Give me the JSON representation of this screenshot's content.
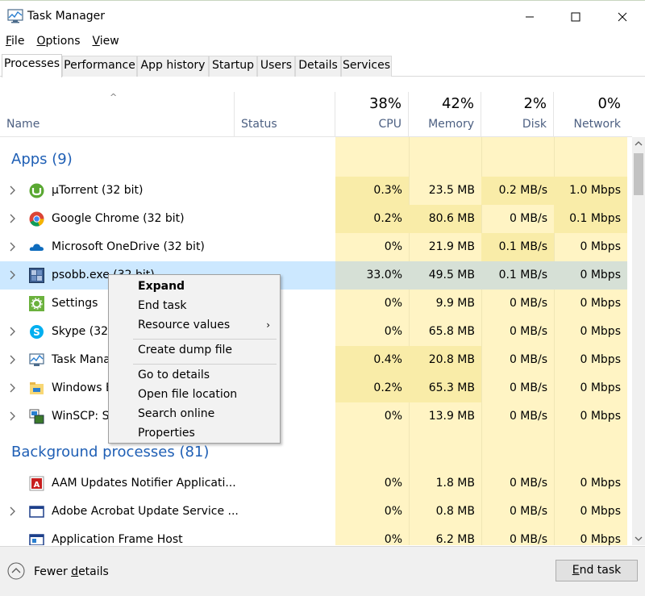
{
  "window": {
    "title": "Task Manager"
  },
  "menu": [
    {
      "label": "F",
      "rest": "ile"
    },
    {
      "label": "O",
      "rest": "ptions"
    },
    {
      "label": "V",
      "rest": "iew"
    }
  ],
  "tabs": [
    "Processes",
    "Performance",
    "App history",
    "Startup",
    "Users",
    "Details",
    "Services"
  ],
  "header": {
    "name": "Name",
    "status": "Status",
    "cpu_pct": "38%",
    "cpu": "CPU",
    "mem_pct": "42%",
    "mem": "Memory",
    "disk_pct": "2%",
    "disk": "Disk",
    "net_pct": "0%",
    "net": "Network"
  },
  "groups": {
    "apps": "Apps (9)",
    "background": "Background processes (81)"
  },
  "rows": [
    {
      "name": "µTorrent (32 bit)",
      "cpu": "0.3%",
      "mem": "23.5 MB",
      "disk": "0.2 MB/s",
      "net": "1.0 Mbps"
    },
    {
      "name": "Google Chrome (32 bit)",
      "cpu": "0.2%",
      "mem": "80.6 MB",
      "disk": "0 MB/s",
      "net": "0.1 Mbps"
    },
    {
      "name": "Microsoft OneDrive (32 bit)",
      "cpu": "0%",
      "mem": "21.9 MB",
      "disk": "0.1 MB/s",
      "net": "0 Mbps"
    },
    {
      "name": "psobb.exe (32 bit)",
      "cpu": "33.0%",
      "mem": "49.5 MB",
      "disk": "0.1 MB/s",
      "net": "0 Mbps"
    },
    {
      "name": "Settings",
      "cpu": "0%",
      "mem": "9.9 MB",
      "disk": "0 MB/s",
      "net": "0 Mbps"
    },
    {
      "name": "Skype (32 bit)",
      "cpu": "0%",
      "mem": "65.8 MB",
      "disk": "0 MB/s",
      "net": "0 Mbps"
    },
    {
      "name": "Task Manager",
      "cpu": "0.4%",
      "mem": "20.8 MB",
      "disk": "0 MB/s",
      "net": "0 Mbps"
    },
    {
      "name": "Windows Explorer",
      "cpu": "0.2%",
      "mem": "65.3 MB",
      "disk": "0 MB/s",
      "net": "0 Mbps"
    },
    {
      "name": "WinSCP: SFTP",
      "cpu": "0%",
      "mem": "13.9 MB",
      "disk": "0 MB/s",
      "net": "0 Mbps"
    },
    {
      "name": "AAM Updates Notifier Applicati...",
      "cpu": "0%",
      "mem": "1.8 MB",
      "disk": "0 MB/s",
      "net": "0 Mbps"
    },
    {
      "name": "Adobe Acrobat Update Service ...",
      "cpu": "0%",
      "mem": "0.8 MB",
      "disk": "0 MB/s",
      "net": "0 Mbps"
    },
    {
      "name": "Application Frame Host",
      "cpu": "0%",
      "mem": "6.2 MB",
      "disk": "0 MB/s",
      "net": "0 Mbps"
    }
  ],
  "context_menu": {
    "expand": "Expand",
    "end_task": "End task",
    "resource_values": "Resource values",
    "create_dump": "Create dump file",
    "go_to_details": "Go to details",
    "open_file_location": "Open file location",
    "search_online": "Search online",
    "properties": "Properties"
  },
  "footer": {
    "fewer_prefix": "Fewer ",
    "fewer_ul": "d",
    "fewer_rest": "etails",
    "end_task_ul": "E",
    "end_task_rest": "nd task"
  },
  "colors": {
    "accent_blue": "#1f5fb5",
    "heat_light": "#fff4c4",
    "heat_mid": "#f9eca8",
    "selection": "#cce8ff"
  }
}
